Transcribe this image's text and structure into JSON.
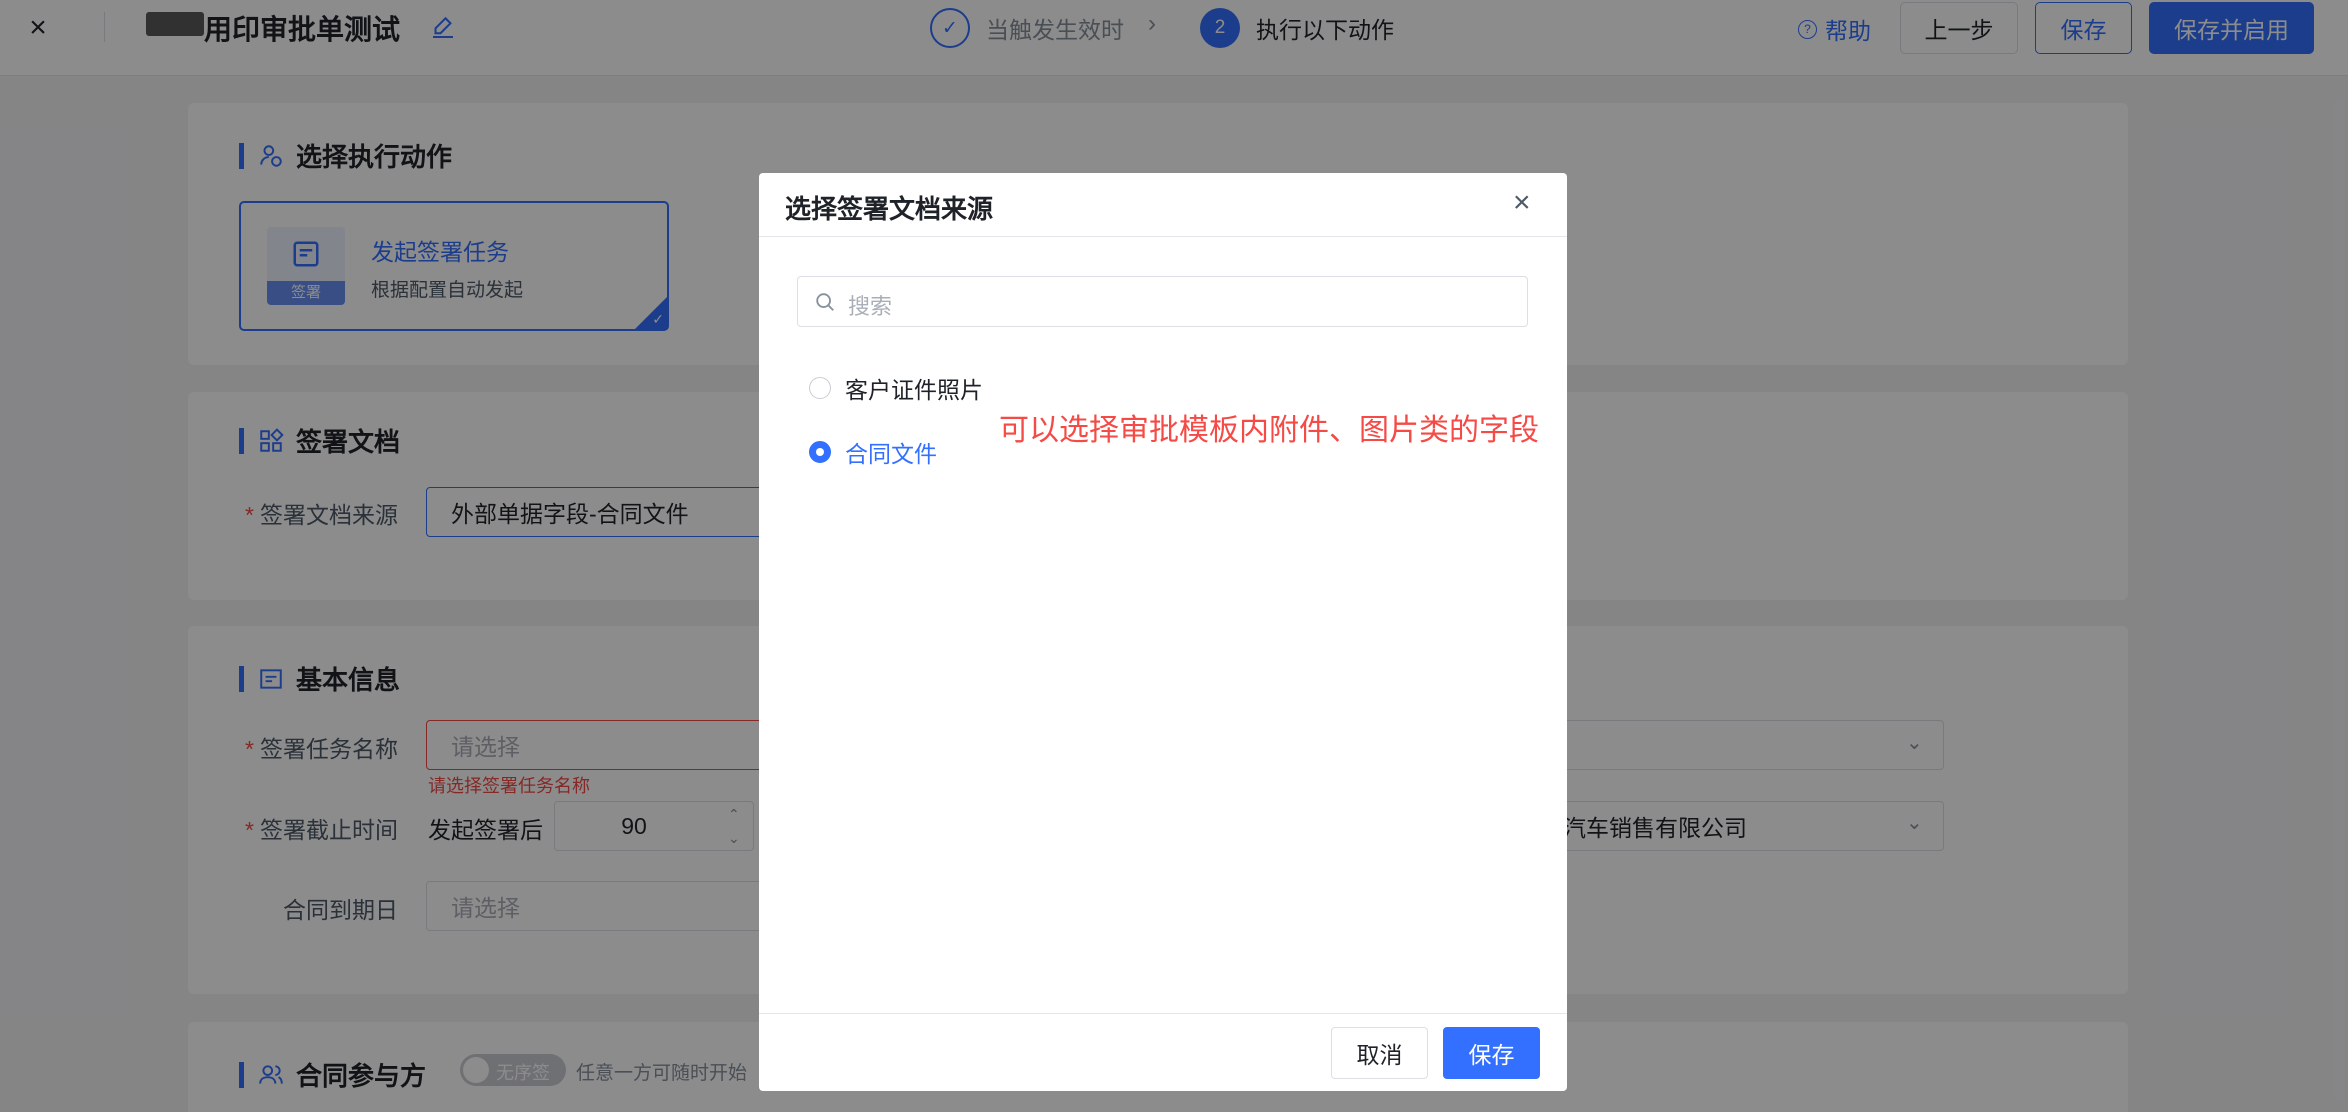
{
  "header": {
    "title": "用印审批单测试",
    "steps": [
      {
        "label": "当触发生效时"
      },
      {
        "number": "2",
        "label": "执行以下动作"
      }
    ],
    "help_label": "帮助",
    "prev_label": "上一步",
    "save_label": "保存",
    "save_enable_label": "保存并启用"
  },
  "section_action": {
    "title": "选择执行动作",
    "card_title": "发起签署任务",
    "card_sub": "根据配置自动发起",
    "card_icon_label": "签署"
  },
  "section_doc": {
    "title": "签署文档",
    "source_label": "签署文档来源",
    "source_value": "外部单据字段-合同文件"
  },
  "section_basic": {
    "title": "基本信息",
    "task_name_label": "签署任务名称",
    "task_name_placeholder": "请选择",
    "task_name_error": "请选择签署任务名称",
    "deadline_label": "签署截止时间",
    "deadline_prefix": "发起签署后",
    "deadline_value": "90",
    "company_value": "汽车销售有限公司",
    "expiry_label": "合同到期日",
    "expiry_placeholder": "请选择"
  },
  "section_parties": {
    "title": "合同参与方",
    "toggle_label": "无序签",
    "hint": "任意一方可随时开始"
  },
  "modal": {
    "title": "选择签署文档来源",
    "search_placeholder": "搜索",
    "options": [
      {
        "label": "客户证件照片",
        "selected": false
      },
      {
        "label": "合同文件",
        "selected": true
      }
    ],
    "annotation": "可以选择审批模板内附件、图片类的字段",
    "cancel_label": "取消",
    "save_label": "保存"
  },
  "colors": {
    "accent": "#3370ff",
    "error": "#f54a45",
    "overlay": "rgba(0,0,0,0.45)"
  }
}
